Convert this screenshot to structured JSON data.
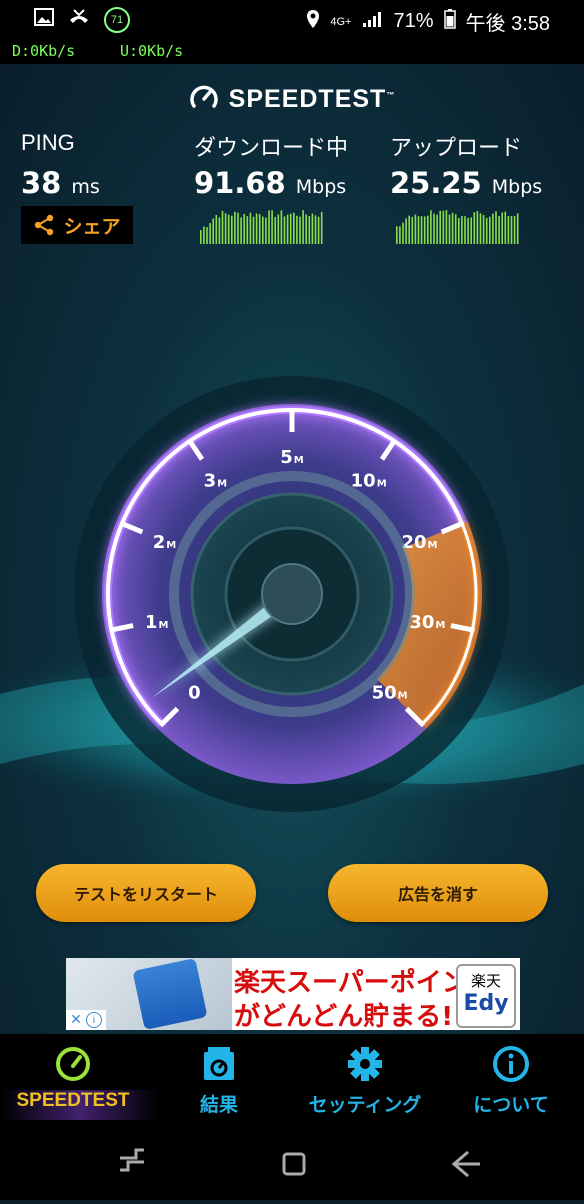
{
  "status_bar": {
    "notifications": [
      "image-icon",
      "missed-call-icon",
      "71"
    ],
    "network": "4G+",
    "battery_percent": "71%",
    "time": "午後 3:58"
  },
  "net_speed": {
    "download": "D:0Kb/s",
    "upload": "U:0Kb/s"
  },
  "app": {
    "logo": "SPEEDTEST",
    "trademark": "™"
  },
  "metrics": {
    "ping": {
      "label": "PING",
      "value": "38",
      "unit": "ms"
    },
    "download": {
      "label": "ダウンロード中",
      "value": "91.68",
      "unit": "Mbps"
    },
    "upload": {
      "label": "アップロード",
      "value": "25.25",
      "unit": "Mbps"
    }
  },
  "share_button": "シェア",
  "gauge": {
    "ticks": [
      {
        "num": "0",
        "unit": ""
      },
      {
        "num": "1",
        "unit": "M"
      },
      {
        "num": "2",
        "unit": "M"
      },
      {
        "num": "3",
        "unit": "M"
      },
      {
        "num": "5",
        "unit": "M"
      },
      {
        "num": "10",
        "unit": "M"
      },
      {
        "num": "20",
        "unit": "M"
      },
      {
        "num": "30",
        "unit": "M"
      },
      {
        "num": "50",
        "unit": "M"
      }
    ],
    "colors": {
      "ring": "#ffffff",
      "glow": "#b07aff",
      "orange": "#e8842a",
      "needle": "#bff7ff"
    }
  },
  "buttons": {
    "restart": "テストをリスタート",
    "remove_ads": "広告を消す"
  },
  "ad": {
    "line1": "楽天スーパーポイント",
    "line2": "がどんどん貯まる!",
    "badge_top": "楽天",
    "badge_bottom": "Edy",
    "close": "✕",
    "info": "i"
  },
  "nav": [
    {
      "label": "SPEEDTEST",
      "icon": "speedometer-icon"
    },
    {
      "label": "結果",
      "icon": "results-icon"
    },
    {
      "label": "セッティング",
      "icon": "gear-icon"
    },
    {
      "label": "について",
      "icon": "info-icon"
    }
  ]
}
